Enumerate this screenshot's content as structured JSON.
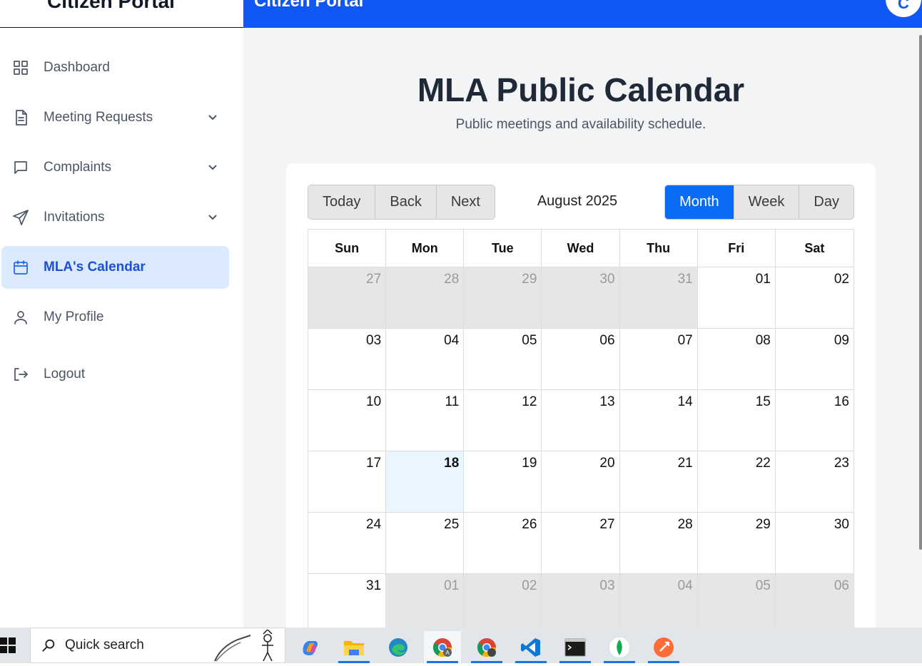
{
  "sidebar": {
    "brand": "Citizen Portal",
    "items": [
      {
        "label": "Dashboard",
        "icon": "grid-icon"
      },
      {
        "label": "Meeting Requests",
        "icon": "document-icon"
      },
      {
        "label": "Complaints",
        "icon": "chat-icon"
      },
      {
        "label": "Invitations",
        "icon": "send-icon"
      },
      {
        "label": "MLA's Calendar",
        "icon": "calendar-icon"
      },
      {
        "label": "My Profile",
        "icon": "user-icon"
      },
      {
        "label": "Logout",
        "icon": "logout-icon"
      }
    ]
  },
  "topbar": {
    "title": "Citizen Portal",
    "avatar": "C",
    "color": "#1057f5"
  },
  "page": {
    "title": "MLA Public Calendar",
    "subtitle": "Public meetings and availability schedule."
  },
  "calendar": {
    "nav_buttons": {
      "today": "Today",
      "back": "Back",
      "next": "Next"
    },
    "month_label": "August 2025",
    "views": {
      "month": "Month",
      "week": "Week",
      "day": "Day"
    },
    "active_view": "Month",
    "weekdays": [
      "Sun",
      "Mon",
      "Tue",
      "Wed",
      "Thu",
      "Fri",
      "Sat"
    ],
    "weeks": [
      [
        "27",
        "28",
        "29",
        "30",
        "31",
        "01",
        "02"
      ],
      [
        "03",
        "04",
        "05",
        "06",
        "07",
        "08",
        "09"
      ],
      [
        "10",
        "11",
        "12",
        "13",
        "14",
        "15",
        "16"
      ],
      [
        "17",
        "18",
        "19",
        "20",
        "21",
        "22",
        "23"
      ],
      [
        "24",
        "25",
        "26",
        "27",
        "28",
        "29",
        "30"
      ],
      [
        "31",
        "01",
        "02",
        "03",
        "04",
        "05",
        "06"
      ]
    ],
    "today": "18",
    "accent": "#0a6cf5"
  },
  "taskbar": {
    "search_placeholder": "Quick search",
    "apps": [
      "copilot-icon",
      "file-explorer-icon",
      "edge-icon",
      "chrome-icon",
      "chrome-profile-icon",
      "vscode-icon",
      "terminal-icon",
      "mongodb-icon",
      "postman-icon"
    ]
  }
}
